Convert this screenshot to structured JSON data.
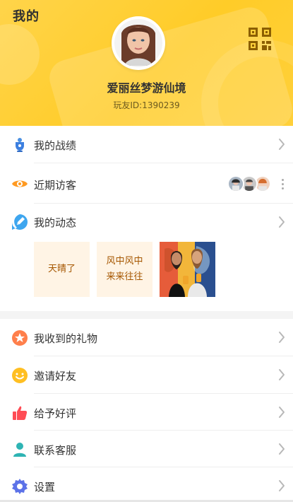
{
  "header": {
    "title": "我的",
    "username": "爱丽丝梦游仙境",
    "user_id": "玩友ID:1390239"
  },
  "menu": {
    "battle": "我的战绩",
    "visitors": "近期访客",
    "dynamic": "我的动态",
    "gifts": "我收到的礼物",
    "invite": "邀请好友",
    "rate": "给予好评",
    "service": "联系客服",
    "settings": "设置"
  },
  "moments": {
    "card1": "天晴了",
    "card2_line1": "风中风中",
    "card2_line2": "来来往往"
  },
  "icons": {
    "qr": "qr-code-icon",
    "battle": "trophy-icon",
    "visitors": "eye-icon",
    "dynamic": "pencil-icon",
    "gifts": "star-icon",
    "invite": "smile-icon",
    "rate": "thumbs-up-icon",
    "service": "customer-service-icon",
    "settings": "gear-icon"
  },
  "colors": {
    "header_yellow": "#ffcf35",
    "text_dark": "#333333",
    "id_text": "#6b5a1f",
    "moment_bg": "#fff4e5",
    "moment_text": "#a55600"
  }
}
